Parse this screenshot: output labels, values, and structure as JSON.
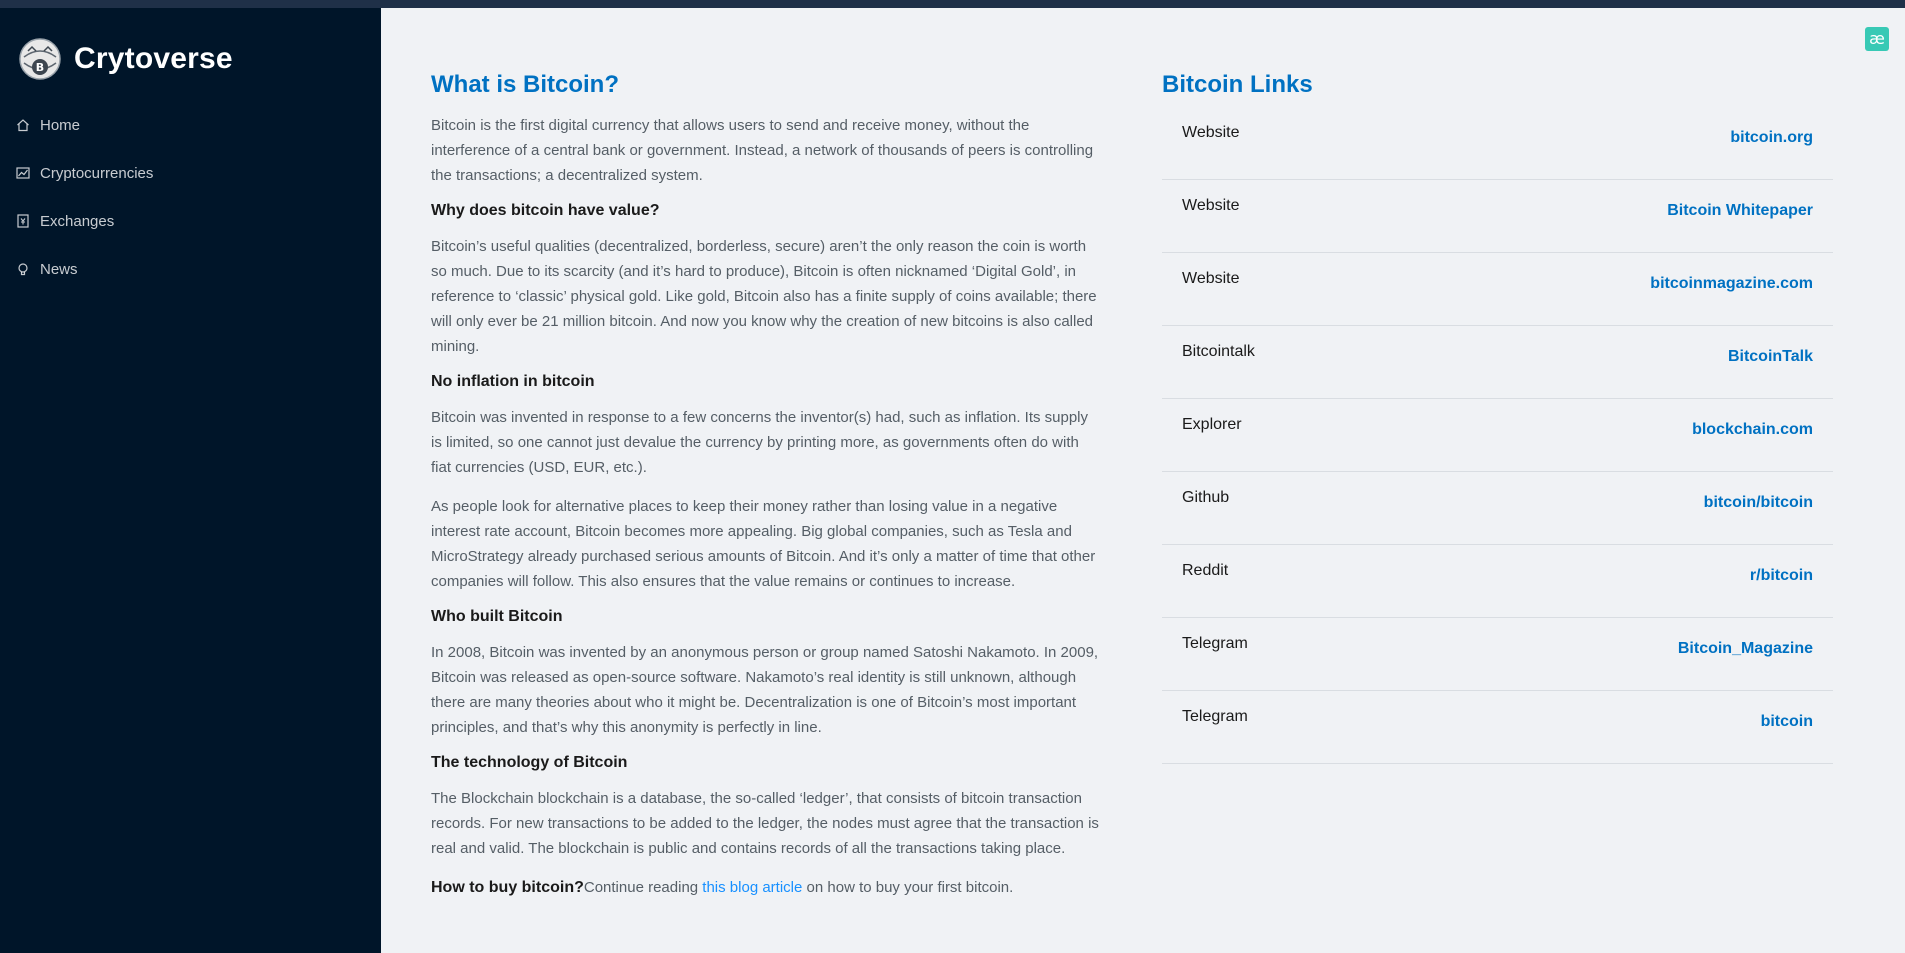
{
  "brand": {
    "name": "Crytoverse",
    "logo_icon": "crypto-globe-logo-icon"
  },
  "nav": [
    {
      "label": "Home",
      "icon": "home-icon"
    },
    {
      "label": "Cryptocurrencies",
      "icon": "fund-icon"
    },
    {
      "label": "Exchanges",
      "icon": "money-collect-icon"
    },
    {
      "label": "News",
      "icon": "bulb-icon"
    }
  ],
  "description": {
    "title": "What is Bitcoin?",
    "intro": "Bitcoin is the first digital currency that allows users to send and receive money, without the interference of a central bank or government. Instead, a network of thousands of peers is controlling the transactions; a decentralized system.",
    "h_value": "Why does bitcoin have value?",
    "p_value": "Bitcoin’s useful qualities (decentralized, borderless, secure) aren’t the only reason the coin is worth so much. Due to its scarcity (and it’s hard to produce), Bitcoin is often nicknamed ‘Digital Gold’, in reference to ‘classic’ physical gold. Like gold, Bitcoin also has a finite supply of coins available; there will only ever be 21 million bitcoin. And now you know why the creation of new bitcoins is also called mining.",
    "h_inflation": "No inflation in bitcoin",
    "p_inflation_1": "Bitcoin was invented in response to a few concerns the inventor(s) had, such as inflation. Its supply is limited, so one cannot just devalue the currency by printing more, as governments often do with fiat currencies (USD, EUR, etc.).",
    "p_inflation_2": "As people look for alternative places to keep their money rather than losing value in a negative interest rate account, Bitcoin becomes more appealing. Big global companies, such as Tesla and MicroStrategy already purchased serious amounts of Bitcoin. And it’s only a matter of time that other companies will follow. This also ensures that the value remains or continues to increase.",
    "h_built": "Who built Bitcoin",
    "p_built": "In 2008, Bitcoin was invented by an anonymous person or group named Satoshi Nakamoto. In 2009, Bitcoin was released as open-source software. Nakamoto’s real identity is still unknown, although there are many theories about who it might be. Decentralization is one of Bitcoin’s most important principles, and that’s why this anonymity is perfectly in line.",
    "h_tech": "The technology of Bitcoin",
    "p_tech": "The Blockchain blockchain is a database, the so-called ‘ledger’, that consists of bitcoin transaction records. For new transactions to be added to the ledger, the nodes must agree that the transaction is real and valid. The blockchain is public and contains records of all the transactions taking place.",
    "buy_bold": "How to buy bitcoin?",
    "buy_text": "Continue reading ",
    "buy_link": "this blog article",
    "buy_tail": " on how to buy your first bitcoin."
  },
  "links": {
    "title": "Bitcoin Links",
    "items": [
      {
        "type": "Website",
        "name": "bitcoin.org"
      },
      {
        "type": "Website",
        "name": "Bitcoin Whitepaper"
      },
      {
        "type": "Website",
        "name": "bitcoinmagazine.com"
      },
      {
        "type": "Bitcointalk",
        "name": "BitcoinTalk"
      },
      {
        "type": "Explorer",
        "name": "blockchain.com"
      },
      {
        "type": "Github",
        "name": "bitcoin/bitcoin"
      },
      {
        "type": "Reddit",
        "name": "r/bitcoin"
      },
      {
        "type": "Telegram",
        "name": "Bitcoin_Magazine"
      },
      {
        "type": "Telegram",
        "name": "bitcoin"
      }
    ]
  },
  "extension": {
    "glyph": "æ",
    "icon": "extension-ae-icon"
  },
  "colors": {
    "sidebar": "#001529",
    "accent": "#0071c2",
    "background": "#f0f2f5"
  }
}
